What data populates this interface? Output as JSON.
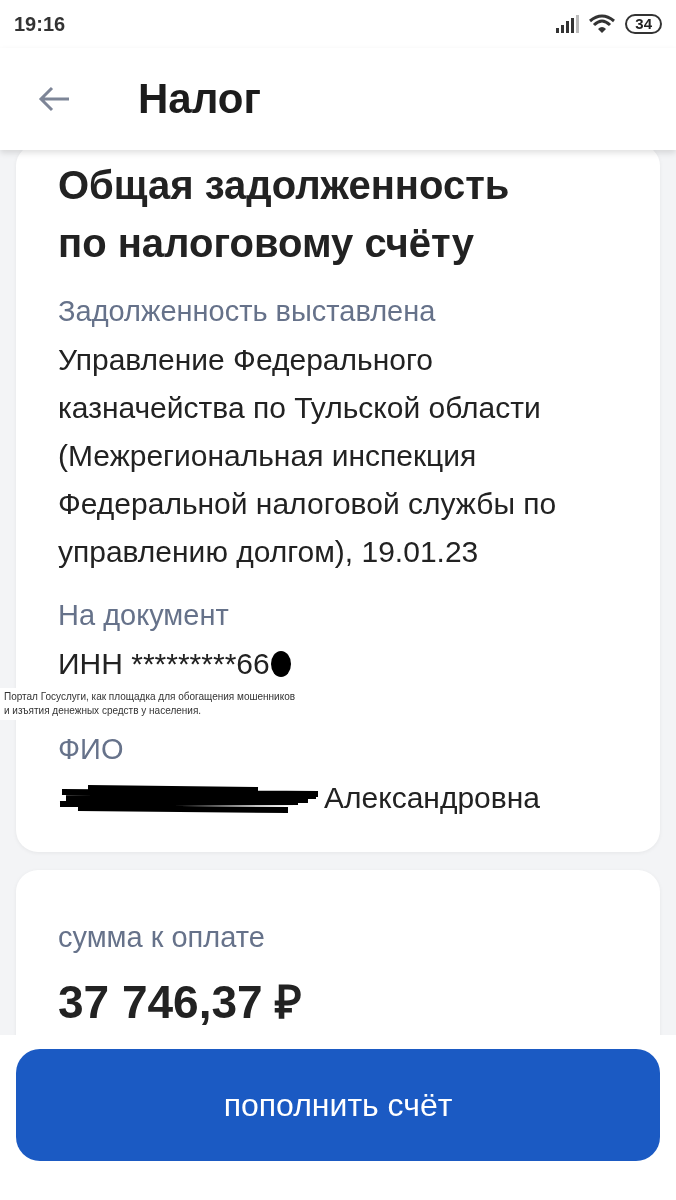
{
  "status_bar": {
    "time": "19:16",
    "battery": "34"
  },
  "header": {
    "title": "Налог"
  },
  "debt_card": {
    "title_lines": [
      "Общая задолженность",
      "по налоговому счёту"
    ],
    "fields": [
      {
        "label": "Задолженность выставлена",
        "value": "Управление Федерального казначейства по Тульской области (Межрегиональная инспекция Федеральной налоговой службы по управлению долгом), 19.01.23"
      },
      {
        "label": "На документ",
        "value": "ИНН *********66",
        "kind": "masked_tail"
      },
      {
        "label": "ФИО",
        "value": "Александровна",
        "kind": "masked_head"
      }
    ]
  },
  "overlay_note": [
    "Портал Госуслуги, как площадка для обогащения мошенников",
    "и изъятия денежных средств у населения."
  ],
  "payment_card": {
    "label": "сумма к оплате",
    "amount": "37 746,37 ₽"
  },
  "button": {
    "label": "пополнить счёт"
  }
}
